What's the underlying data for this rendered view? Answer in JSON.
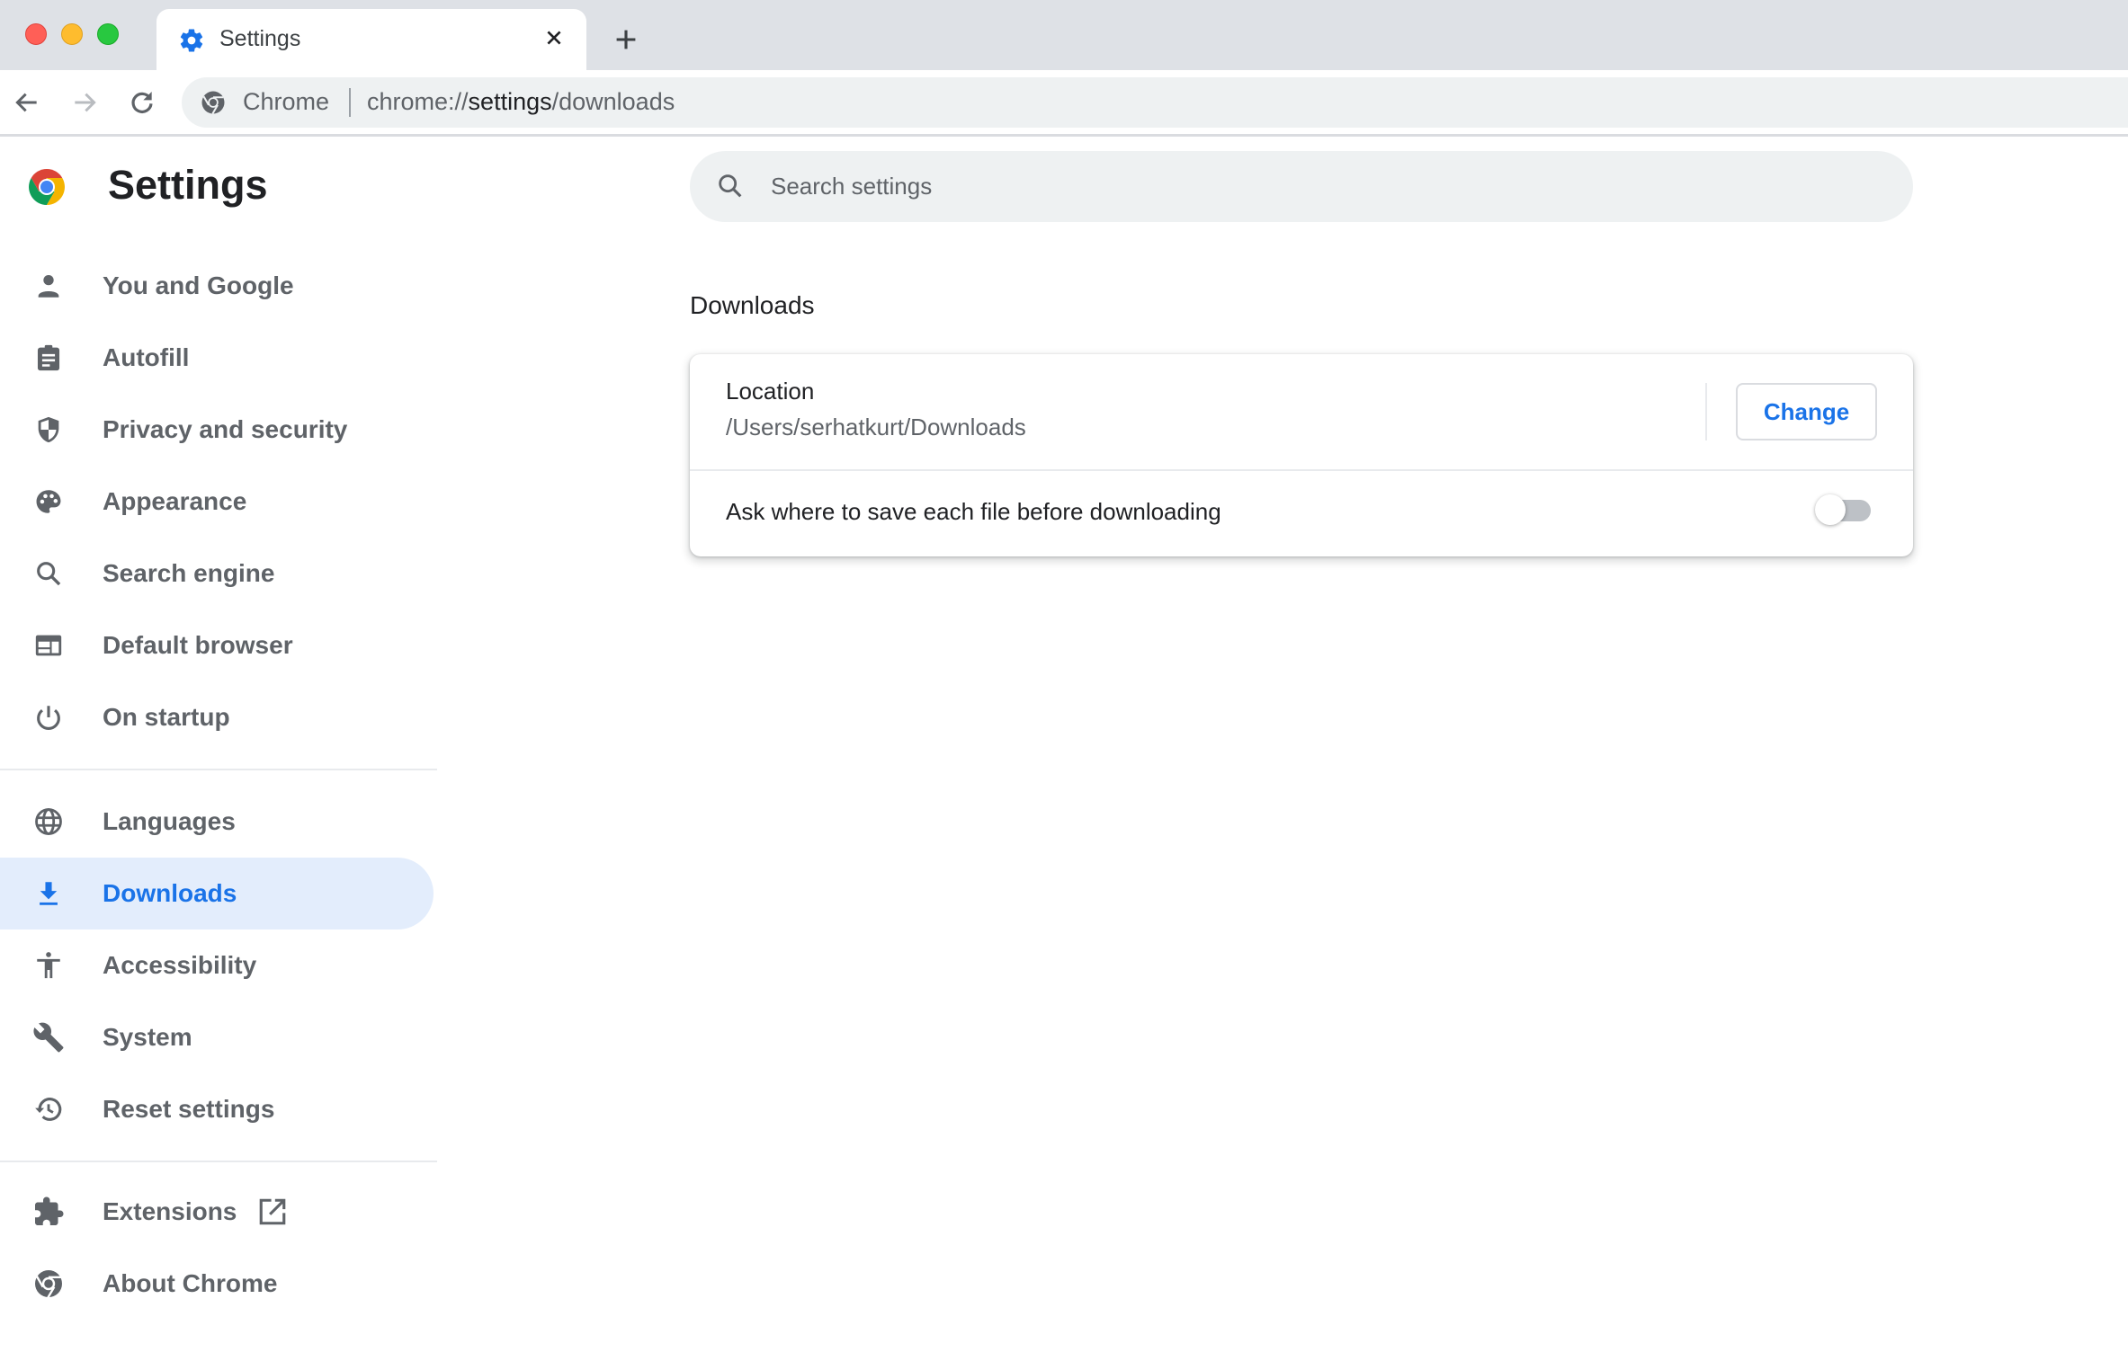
{
  "window": {
    "controls": [
      "close",
      "minimize",
      "maximize"
    ]
  },
  "tabs": [
    {
      "title": "Settings",
      "icon": "gear-icon",
      "active": true
    }
  ],
  "toolbar": {
    "back_icon": "arrow-left-icon",
    "forward_icon": "arrow-right-icon",
    "reload_icon": "reload-icon",
    "omnibox": {
      "chip": "Chrome",
      "url_scheme": "chrome://",
      "url_host": "settings",
      "url_path": "/downloads"
    }
  },
  "sidebar": {
    "title": "Settings",
    "items": [
      {
        "label": "You and Google",
        "icon": "person-icon"
      },
      {
        "label": "Autofill",
        "icon": "clipboard-icon"
      },
      {
        "label": "Privacy and security",
        "icon": "shield-icon"
      },
      {
        "label": "Appearance",
        "icon": "palette-icon"
      },
      {
        "label": "Search engine",
        "icon": "search-icon"
      },
      {
        "label": "Default browser",
        "icon": "browser-window-icon"
      },
      {
        "label": "On startup",
        "icon": "power-icon"
      },
      {
        "label": "Languages",
        "icon": "globe-icon"
      },
      {
        "label": "Downloads",
        "icon": "download-icon",
        "active": true
      },
      {
        "label": "Accessibility",
        "icon": "accessibility-icon"
      },
      {
        "label": "System",
        "icon": "wrench-icon"
      },
      {
        "label": "Reset settings",
        "icon": "history-icon"
      },
      {
        "label": "Extensions",
        "icon": "puzzle-icon",
        "external_link_icon": "open-in-new-icon"
      },
      {
        "label": "About Chrome",
        "icon": "chrome-icon"
      }
    ]
  },
  "search": {
    "placeholder": "Search settings",
    "value": ""
  },
  "main": {
    "section_title": "Downloads",
    "location": {
      "label": "Location",
      "path": "/Users/serhatkurt/Downloads",
      "button_label": "Change"
    },
    "ask_where": {
      "label": "Ask where to save each file before downloading",
      "enabled": false
    }
  },
  "colors": {
    "accent": "#1a73e8",
    "active_nav_bg": "#e3edfc",
    "tabstrip_bg": "#dee1e6",
    "omnibox_bg": "#eef1f2",
    "text_secondary": "#5f6368"
  }
}
